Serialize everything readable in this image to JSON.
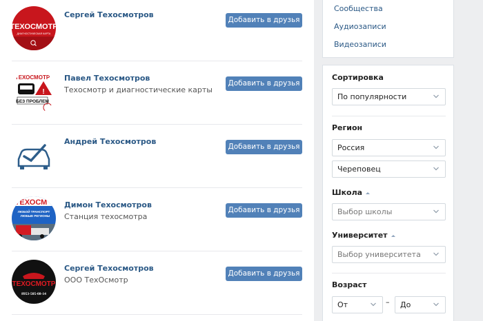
{
  "people": [
    {
      "name": "Сергей Техосмотров",
      "subtitle": "",
      "add_label": "Добавить в друзья"
    },
    {
      "name": "Павел Техосмотров",
      "subtitle": "Техосмотр и диагностические карты",
      "add_label": "Добавить в друзья"
    },
    {
      "name": "Андрей Техосмотров",
      "subtitle": "",
      "add_label": "Добавить в друзья"
    },
    {
      "name": "Димон Техосмотров",
      "subtitle": "Станция техосмотра",
      "add_label": "Добавить в друзья"
    },
    {
      "name": "Сергей Техосмотров",
      "subtitle": "ООО ТехОсмотр",
      "add_label": "Добавить в друзья"
    }
  ],
  "avatars": {
    "a1_title": "ТЕХОСМОТР",
    "a1_sub": "ДИАГНОСТИЧЕСКАЯ КАРТА",
    "a2_top": "ТЕХОСМОТР",
    "a2_bottom": "БЕЗ ПРОБЛЕМ",
    "a4_top": "ТЕХОСМ",
    "a4_line1": "ЛЮБОЙ ТРАНСПОРТ",
    "a4_line2": "ЛЮБЫЕ РЕГИОНЫ",
    "a5_title": "ТЕХОСМОТР",
    "a5_phone": "8953-505-08-14"
  },
  "sections": {
    "links": [
      "Сообщества",
      "Аудиозаписи",
      "Видеозаписи"
    ]
  },
  "filters": {
    "sort_label": "Сортировка",
    "sort_value": "По популярности",
    "region_label": "Регион",
    "country_value": "Россия",
    "city_value": "Череповец",
    "school_label": "Школа",
    "school_placeholder": "Выбор школы",
    "university_label": "Университет",
    "university_placeholder": "Выбор университета",
    "age_label": "Возраст",
    "age_from": "От",
    "age_dash": "–",
    "age_to": "До"
  },
  "colors": {
    "link": "#2a5885",
    "button": "#5181b8",
    "background": "#edeef0"
  }
}
